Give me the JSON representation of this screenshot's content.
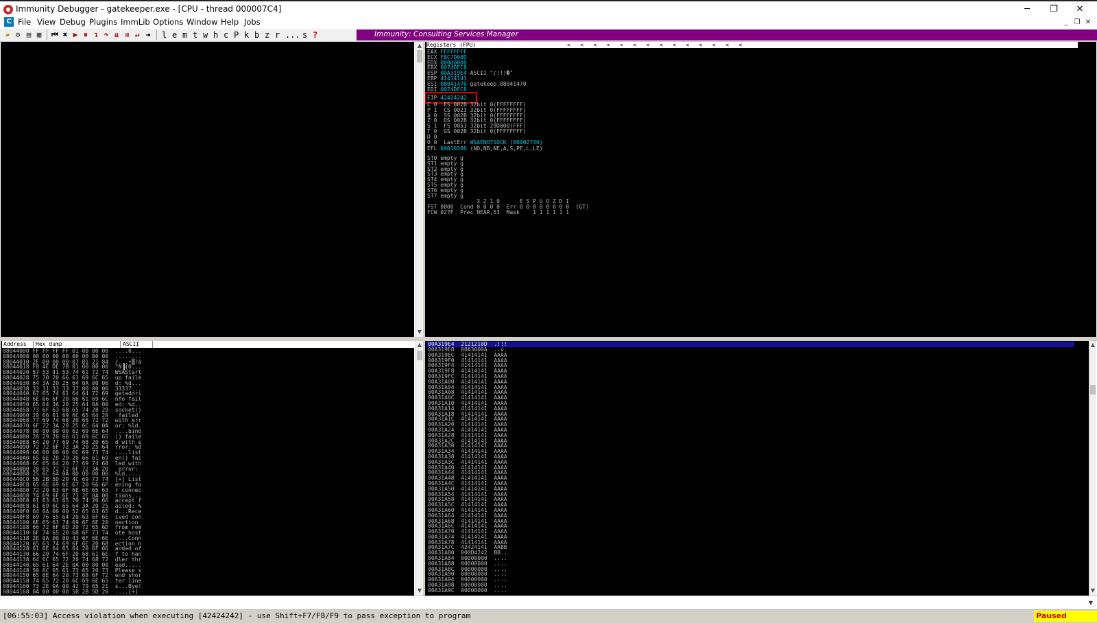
{
  "window": {
    "title": "Immunity Debugger - gatekeeper.exe - [CPU - thread 000007C4]",
    "minimize": "─",
    "restore": "❐",
    "close": "✕"
  },
  "menu": {
    "items": [
      "File",
      "View",
      "Debug",
      "Plugins",
      "ImmLib",
      "Options",
      "Window",
      "Help",
      "Jobs"
    ],
    "mdi_min": "_",
    "mdi_restore": "❐",
    "mdi_close": "✕"
  },
  "toolbar": {
    "letters": [
      "l",
      "e",
      "m",
      "t",
      "w",
      "h",
      "c",
      "P",
      "k",
      "b",
      "z",
      "r",
      "...",
      "s",
      "?"
    ],
    "banner": "Immunity: Consulting Services Manager"
  },
  "registers": {
    "header": "Registers (FPU)",
    "arrows": "<   <   <   <   <   <   <   <   <   <   <   <   <   <",
    "gpr": [
      {
        "name": "EAX",
        "value": "FFFFFFFF",
        "comment": ""
      },
      {
        "name": "ECX",
        "value": "F8C7D08D",
        "comment": ""
      },
      {
        "name": "EDX",
        "value": "00000000",
        "comment": ""
      },
      {
        "name": "EBX",
        "value": "0074DFC8",
        "comment": ""
      },
      {
        "name": "ESP",
        "value": "00A319E4",
        "comment": "ASCII \"♪!!!�\""
      },
      {
        "name": "EBP",
        "value": "41414141",
        "comment": ""
      },
      {
        "name": "ESI",
        "value": "08041470",
        "comment": "gatekeep.08041470"
      },
      {
        "name": "EDI",
        "value": "0074DFC8",
        "comment": ""
      }
    ],
    "eip": {
      "name": "EIP",
      "value": "42424242"
    },
    "flags": [
      "C 0  ES 002B 32bit 0(FFFFFFFF)",
      "P 1  CS 0023 32bit 0(FFFFFFFF)",
      "A 0  SS 002B 32bit 0(FFFFFFFF)",
      "Z 0  DS 002B 32bit 0(FFFFFFFF)",
      "S 1  FS 0053 32bit 29D000(FFF)",
      "T 0  GS 002B 32bit 0(FFFFFFFF)",
      "D 0",
      "O 0  LastErr "
    ],
    "lasterr": "WSAENOTSOCK (00002736)",
    "efl_label": "EFL",
    "efl_value": "00010286",
    "efl_comment": "(NO,NB,NE,A,S,PE,L,LE)",
    "fpu": [
      "ST0 empty g",
      "ST1 empty g",
      "ST2 empty g",
      "ST3 empty g",
      "ST4 empty g",
      "ST5 empty g",
      "ST6 empty g",
      "ST7 empty g"
    ],
    "fpu_footer": [
      "               3 2 1 0      E S P U O Z D I",
      "FST 0000  Cond 0 0 0 0  Err 0 0 0 0 0 0 0 0  (GT)",
      "FCW 027F  Prec NEAR,53  Mask    1 1 1 1 1 1"
    ]
  },
  "dump": {
    "col_address": "Address",
    "col_hex": "Hex dump",
    "col_ascii": "ASCII",
    "rows": [
      "08044000 FF FF FF FF 01 00 00 00  ....0...",
      "08044008 00 00 00 00 00 00 00 00  ........",
      "08044010 2F 00 00 00 07 B1 21 84  /...•▒!ä",
      "08044018 F8 4E DE 7B 01 00 00 00  °N▐{0...",
      "08044020 57 53 41 53 74 61 72 74  WSAStart",
      "08044028 75 70 20 66 61 69 6C 65  up faile",
      "08044030 64 3A 20 25 64 0A 00 00  d: %d...",
      "08044038 33 31 33 33 37 00 00 00  31337...",
      "08044040 67 65 74 61 64 64 72 69  getaddri",
      "08044048 6E 66 6F 20 66 61 69 6C  nfo fail",
      "08044050 65 64 3A 20 25 64 0A 00  ed: %d..",
      "08044058 73 6F 63 6B 65 74 28 29  socket()",
      "08044060 20 66 61 69 6C 65 64 20   failed ",
      "08044068 77 69 74 68 20 65 72 72  with err",
      "08044070 6F 72 3A 20 25 6C 64 0A  or: %ld.",
      "08044078 00 00 00 00 62 69 6E 64  ....bind",
      "08044080 28 29 20 66 61 69 6C 65  () faile",
      "08044088 64 20 77 69 74 68 20 65  d with e",
      "08044090 72 72 6F 72 3A 20 25 64  rror: %d",
      "08044098 0A 00 00 00 6C 69 73 74  ....list",
      "080440A0 65 6E 28 29 20 66 61 69  en() fai",
      "080440A8 6C 65 64 20 77 69 74 68  led with",
      "080440B0 20 65 72 72 6F 72 3A 20   error: ",
      "080440B8 25 6C 64 0A 00 00 00 00  %ld.....",
      "080440C0 5B 2B 5D 20 4C 69 73 74  [+] List",
      "080440C8 65 6E 69 6E 67 20 66 6F  ening fo",
      "080440D0 72 20 63 6F 6E 6E 65 63  r connec",
      "080440D8 74 69 6F 6E 73 2E 0A 00  tions...",
      "080440E0 61 63 63 65 70 74 20 66  accept f",
      "080440E8 61 69 6C 65 64 3A 20 25  ailed: %",
      "080440F0 64 0A 00 00 52 65 63 65  d...Rece",
      "080440F8 69 76 65 64 20 63 6F 6E  ived con",
      "08044100 6E 65 63 74 69 6F 6E 20  nection ",
      "08044108 66 72 6F 6D 20 72 65 6D  from rem",
      "08044110 6F 74 65 20 68 6F 73 74  ote host",
      "08044118 2E 0A 00 00 43 6F 6E 6E  ....Conn",
      "08044120 65 63 74 69 6F 6E 20 68  ection h",
      "08044128 61 6E 64 65 64 20 6F 66  anded of",
      "08044130 66 20 74 6F 20 68 61 6E  f to han",
      "08044138 64 6C 65 72 20 74 68 72  dler thr",
      "08044140 65 61 64 2E 0A 00 00 00  ead.....",
      "08044148 50 6C 65 61 73 65 20 73  Please s",
      "08044150 65 6E 64 20 73 68 6F 72  end shor",
      "08044158 74 65 72 20 6C 69 6E 65  ter line",
      "08044160 73 2E 0A 00 42 79 65 21  s...Bye!",
      "08044168 0A 00 00 00 5B 2B 5D 20  ....[+] "
    ]
  },
  "stack": {
    "highlight": "00A319E4  2121210D  .!!!",
    "rows": [
      "00A319E8  00A3000A  ..ú.",
      "00A319EC  41414141  AAAA",
      "00A319F0  41414141  AAAA",
      "00A319F4  41414141  AAAA",
      "00A319F8  41414141  AAAA",
      "00A319FC  41414141  AAAA",
      "00A31A00  41414141  AAAA",
      "00A31A04  41414141  AAAA",
      "00A31A08  41414141  AAAA",
      "00A31A0C  41414141  AAAA",
      "00A31A10  41414141  AAAA",
      "00A31A14  41414141  AAAA",
      "00A31A18  41414141  AAAA",
      "00A31A1C  41414141  AAAA",
      "00A31A20  41414141  AAAA",
      "00A31A24  41414141  AAAA",
      "00A31A28  41414141  AAAA",
      "00A31A2C  41414141  AAAA",
      "00A31A30  41414141  AAAA",
      "00A31A34  41414141  AAAA",
      "00A31A38  41414141  AAAA",
      "00A31A3C  41414141  AAAA",
      "00A31A40  41414141  AAAA",
      "00A31A44  41414141  AAAA",
      "00A31A48  41414141  AAAA",
      "00A31A4C  41414141  AAAA",
      "00A31A50  41414141  AAAA",
      "00A31A54  41414141  AAAA",
      "00A31A58  41414141  AAAA",
      "00A31A5C  41414141  AAAA",
      "00A31A60  41414141  AAAA",
      "00A31A64  41414141  AAAA",
      "00A31A68  41414141  AAAA",
      "00A31A6C  41414141  AAAA",
      "00A31A70  41414141  AAAA",
      "00A31A74  41414141  AAAA",
      "00A31A78  41414141  AAAA",
      "00A31A7C  42424141  AABB",
      "00A31A80  000D4242  BB..",
      "00A31A84  00000000  ....",
      "00A31A88  00000000  ....",
      "00A31A8C  00000000  ....",
      "00A31A90  00000000  ....",
      "00A31A94  00000000  ....",
      "00A31A98  00000000  ....",
      "00A31A9C  00000000  ...."
    ]
  },
  "status": {
    "message": "[06:55:03] Access violation when executing [42424242] - use Shift+F7/F8/F9 to pass exception to program",
    "state": "Paused"
  },
  "colors": {
    "banner": "#800080",
    "paused_bg": "#ffff00",
    "paused_fg": "#d00000",
    "eip_box": "#e00000",
    "stack_highlight": "#1010a0"
  }
}
